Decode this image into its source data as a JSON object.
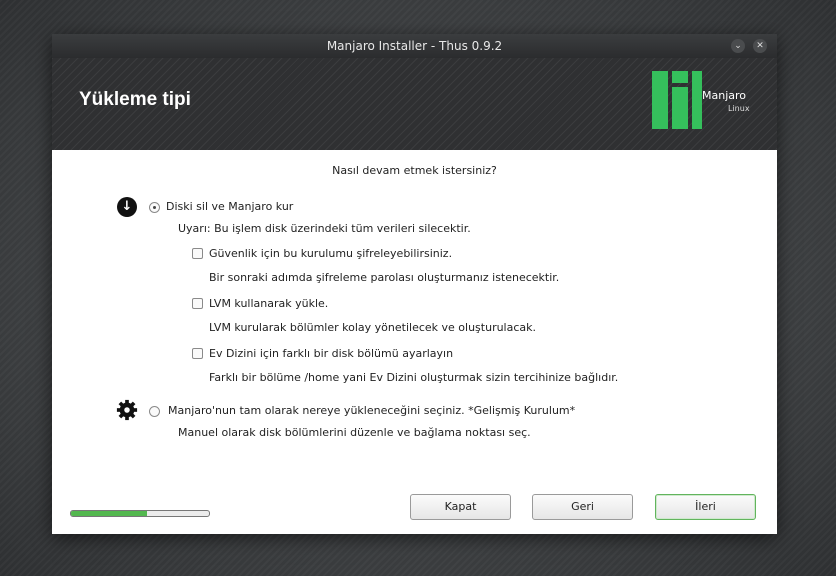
{
  "window": {
    "title": "Manjaro Installer - Thus 0.9.2",
    "minimize_icon": "chevron-down-icon",
    "close_icon": "close-icon"
  },
  "header": {
    "title": "Yükleme tipi",
    "logo_text": "Manjaro",
    "logo_subtext": "Linux"
  },
  "main": {
    "question": "Nasıl devam etmek istersiniz?",
    "option_erase": {
      "label": "Diski sil ve Manjaro kur",
      "selected": true,
      "warning": "Uyarı: Bu işlem disk üzerindeki tüm verileri silecektir.",
      "icon": "download-icon",
      "sub_options": [
        {
          "label": "Güvenlik için bu kurulumu şifreleyebilirsiniz.",
          "description": "Bir sonraki adımda şifreleme parolası oluşturmanız istenecektir.",
          "checked": false
        },
        {
          "label": "LVM kullanarak yükle.",
          "description": "LVM kurularak bölümler kolay yönetilecek ve oluşturulacak.",
          "checked": false
        },
        {
          "label": "Ev Dizini için farklı bir disk bölümü ayarlayın",
          "description": "Farklı bir bölüme /home yani Ev Dizini oluşturmak sizin tercihinize bağlıdır.",
          "checked": false
        }
      ]
    },
    "option_advanced": {
      "label": "Manjaro'nun tam olarak nereye yükleneceğini seçiniz. *Gelişmiş Kurulum*",
      "selected": false,
      "description": "Manuel olarak disk bölümlerini düzenle ve bağlama noktası seç.",
      "icon": "gear-icon"
    }
  },
  "footer": {
    "progress": 0.55,
    "buttons": {
      "close": "Kapat",
      "back": "Geri",
      "next": "İleri"
    }
  },
  "colors": {
    "accent": "#53b84f",
    "logo_green": "#35bf5c",
    "header_bg": "#2f3032",
    "window_bg": "#ffffff"
  }
}
